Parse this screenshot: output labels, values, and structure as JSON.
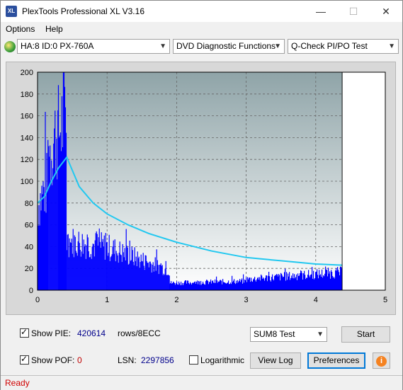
{
  "window": {
    "app_icon_text": "XL",
    "title": "PlexTools Professional XL V3.16",
    "minimize": "—",
    "maximize": "☐",
    "close": "✕"
  },
  "menu": {
    "options": "Options",
    "help": "Help"
  },
  "toolbar": {
    "drive": "HA:8 ID:0  PX-760A",
    "function": "DVD Diagnostic Functions",
    "test": "Q-Check PI/PO Test"
  },
  "chart_data": {
    "type": "bar",
    "xlim": [
      0,
      5
    ],
    "ylim": [
      0,
      200
    ],
    "x_ticks": [
      "0",
      "1",
      "2",
      "3",
      "4",
      "5"
    ],
    "y_ticks": [
      "0",
      "20",
      "40",
      "60",
      "80",
      "100",
      "120",
      "140",
      "160",
      "180",
      "200"
    ],
    "grid": true,
    "end_marker_x": 4.38,
    "pie_series": {
      "color": "#0000ff",
      "segments": [
        {
          "x_start": 0.0,
          "x_end": 0.15,
          "y_start": 95,
          "y_end": 120
        },
        {
          "x_start": 0.15,
          "x_end": 0.3,
          "y_start": 150,
          "y_end": 180
        },
        {
          "x_start": 0.3,
          "x_end": 0.42,
          "y_start": 175,
          "y_end": 200
        },
        {
          "x_start": 0.42,
          "x_end": 1.0,
          "y_start": 55,
          "y_end": 48
        },
        {
          "x_start": 1.0,
          "x_end": 1.9,
          "y_start": 48,
          "y_end": 22
        },
        {
          "x_start": 1.9,
          "x_end": 3.0,
          "y_start": 8,
          "y_end": 10
        },
        {
          "x_start": 3.0,
          "x_end": 4.38,
          "y_start": 12,
          "y_end": 20
        }
      ]
    },
    "po_curve": {
      "color": "#22c8f0",
      "x": [
        0.0,
        0.1,
        0.2,
        0.3,
        0.42,
        0.6,
        0.8,
        1.0,
        1.3,
        1.6,
        2.0,
        2.5,
        3.0,
        3.5,
        4.0,
        4.38
      ],
      "y": [
        80,
        86,
        100,
        112,
        122,
        95,
        80,
        70,
        60,
        52,
        44,
        36,
        30,
        27,
        24,
        23
      ]
    }
  },
  "bottom": {
    "show_pie_label": "Show PIE:",
    "pie_value": "420614",
    "rows_unit": "rows/8ECC",
    "sum8_select": "SUM8 Test",
    "start_button": "Start",
    "show_poe_label": "Show POF:",
    "poe_value": "0",
    "lsn_label": "LSN:",
    "lsn_value": "2297856",
    "logarithmic_label": "Logarithmic",
    "view_log_button": "View Log",
    "preferences_button": "Preferences",
    "info_icon_glyph": "i"
  },
  "status": {
    "text": "Ready"
  }
}
